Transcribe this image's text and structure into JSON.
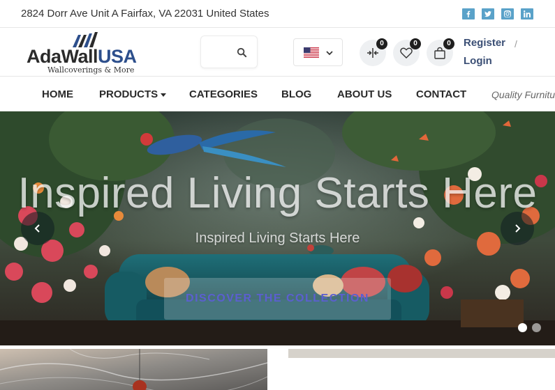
{
  "topbar": {
    "address": "2824 Dorr Ave Unit A Fairfax, VA 22031 United States",
    "social": [
      {
        "name": "facebook-icon"
      },
      {
        "name": "twitter-icon"
      },
      {
        "name": "instagram-icon"
      },
      {
        "name": "linkedin-icon"
      }
    ]
  },
  "header": {
    "logo": {
      "brand_primary": "AdaWall",
      "brand_secondary": "USA",
      "tagline": "Wallcoverings & More"
    },
    "language": {
      "selected": "us-flag-icon"
    },
    "counters": {
      "compare": "0",
      "wishlist": "0",
      "cart": "0"
    },
    "auth": {
      "register": "Register",
      "separator": "/",
      "login": "Login"
    }
  },
  "nav": {
    "items": [
      "HOME",
      "PRODUCTS",
      "CATEGORIES",
      "BLOG",
      "ABOUT US",
      "CONTACT"
    ],
    "marquee": "Quality Furnitu"
  },
  "hero": {
    "title": "Inspired Living Starts Here",
    "subtitle": "Inspired Living Starts Here",
    "cta": "DISCOVER THE COLLECTION",
    "active_slide": 1,
    "slide_count": 2
  },
  "colors": {
    "accent": "#3b4f75",
    "social": "#5aa2c9",
    "cta_text": "#5b5fd0",
    "logo_blue": "#2d4f8c"
  }
}
